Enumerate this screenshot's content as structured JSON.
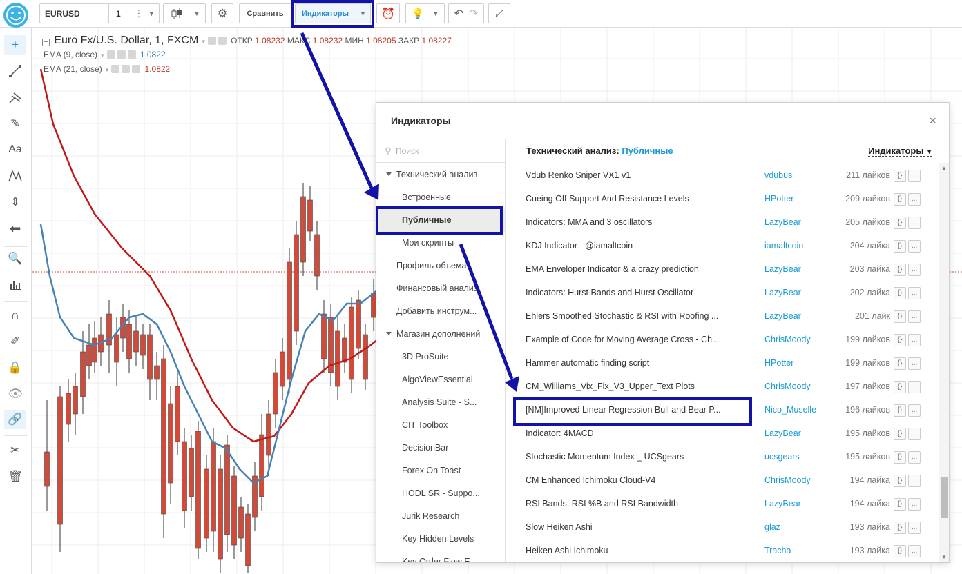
{
  "toolbar": {
    "symbol": "EURUSD",
    "interval": "1",
    "compare_label": "Сравнить",
    "indicators_label": "Индикаторы"
  },
  "chart": {
    "title": "Euro Fx/U.S. Dollar, 1, FXCM",
    "ohlc": {
      "open_label": "ОТКР",
      "open": "1.08232",
      "high_label": "МАКС",
      "high": "1.08232",
      "low_label": "МИН",
      "low": "1.08205",
      "close_label": "ЗАКР",
      "close": "1.08227"
    },
    "ema9": {
      "label": "EMA (9, close)",
      "value": "1.0822"
    },
    "ema21": {
      "label": "EMA (21, close)",
      "value": "1.0822"
    },
    "colors": {
      "up": "#5e9c6e",
      "down": "#d24a3a",
      "ema9": "#4682b4",
      "ema21": "#c11818"
    }
  },
  "dialog": {
    "title": "Индикаторы",
    "close": "×",
    "search_placeholder": "Поиск",
    "header_label": "Технический анализ:",
    "header_link": "Публичные",
    "header_right": "Индикаторы",
    "sidebar": [
      {
        "label": "Технический анализ",
        "kind": "grp"
      },
      {
        "label": "Встроенные",
        "kind": "sub"
      },
      {
        "label": "Публичные",
        "kind": "sub",
        "active": true
      },
      {
        "label": "Мои скрипты",
        "kind": "sub"
      },
      {
        "label": "Профиль объема",
        "kind": "top"
      },
      {
        "label": "Финансовый анализ",
        "kind": "top"
      },
      {
        "label": "Добавить инструм...",
        "kind": "top"
      },
      {
        "label": "Магазин дополнений",
        "kind": "grp"
      },
      {
        "label": "3D ProSuite",
        "kind": "sub"
      },
      {
        "label": "AlgoViewEssential",
        "kind": "sub"
      },
      {
        "label": "Analysis Suite - S...",
        "kind": "sub"
      },
      {
        "label": "CIT Toolbox",
        "kind": "sub"
      },
      {
        "label": "DecisionBar",
        "kind": "sub"
      },
      {
        "label": "Forex On Toast",
        "kind": "sub"
      },
      {
        "label": "HODL SR - Suppo...",
        "kind": "sub"
      },
      {
        "label": "Jurik Research",
        "kind": "sub"
      },
      {
        "label": "Key Hidden Levels",
        "kind": "sub"
      },
      {
        "label": "Key Order Flow E...",
        "kind": "sub"
      }
    ],
    "rows": [
      {
        "name": "Vdub Renko Sniper VX1 v1",
        "author": "vdubus",
        "likes": "211 лайков"
      },
      {
        "name": "Cueing Off Support And Resistance Levels",
        "author": "HPotter",
        "likes": "209 лайков"
      },
      {
        "name": "Indicators: MMA and 3 oscillators",
        "author": "LazyBear",
        "likes": "205 лайков"
      },
      {
        "name": "KDJ Indicator - @iamaltcoin",
        "author": "iamaltcoin",
        "likes": "204 лайка"
      },
      {
        "name": "EMA Enveloper Indicator & a crazy prediction",
        "author": "LazyBear",
        "likes": "203 лайка"
      },
      {
        "name": "Indicators: Hurst Bands and Hurst Oscillator",
        "author": "LazyBear",
        "likes": "202 лайка"
      },
      {
        "name": "Ehlers Smoothed Stochastic & RSI with Roofing ...",
        "author": "LazyBear",
        "likes": "201 лайк"
      },
      {
        "name": "Example of Code for Moving Average Cross - Ch...",
        "author": "ChrisMoody",
        "likes": "199 лайков"
      },
      {
        "name": "Hammer automatic finding script",
        "author": "HPotter",
        "likes": "199 лайков"
      },
      {
        "name": "CM_Williams_Vix_Fix_V3_Upper_Text Plots",
        "author": "ChrisMoody",
        "likes": "197 лайков"
      },
      {
        "name": "[NM]Improved Linear Regression Bull and Bear P...",
        "author": "Nico_Muselle",
        "likes": "196 лайков"
      },
      {
        "name": "Indicator: 4MACD",
        "author": "LazyBear",
        "likes": "195 лайков"
      },
      {
        "name": "Stochastic Momentum Index _ UCSgears",
        "author": "ucsgears",
        "likes": "195 лайков"
      },
      {
        "name": "CM Enhanced Ichimoku Cloud-V4",
        "author": "ChrisMoody",
        "likes": "194 лайка"
      },
      {
        "name": "RSI Bands, RSI %B and RSI Bandwidth",
        "author": "LazyBear",
        "likes": "194 лайка"
      },
      {
        "name": "Slow Heiken Ashi",
        "author": "glaz",
        "likes": "193 лайка"
      },
      {
        "name": "Heiken Ashi Ichimoku",
        "author": "Tracha",
        "likes": "193 лайка"
      }
    ],
    "code_btn": "{}",
    "more_btn": "..."
  }
}
